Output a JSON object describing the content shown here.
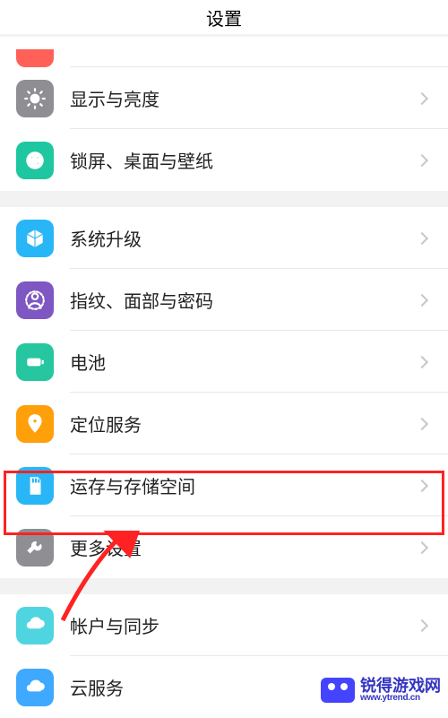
{
  "header": {
    "title": "设置"
  },
  "partial_row": {
    "icon": "sound-icon",
    "color": "#ff6159"
  },
  "groups": [
    {
      "items": [
        {
          "key": "display",
          "label": "显示与亮度",
          "icon": "brightness-icon",
          "color": "#8e8e93"
        },
        {
          "key": "wallpaper",
          "label": "锁屏、桌面与壁纸",
          "icon": "palette-icon",
          "color": "#1fc7a0"
        }
      ]
    },
    {
      "items": [
        {
          "key": "system-update",
          "label": "系统升级",
          "icon": "cube-icon",
          "color": "#29b6f6"
        },
        {
          "key": "biometrics",
          "label": "指纹、面部与密码",
          "icon": "fingerprint-icon",
          "color": "#7e57c2"
        },
        {
          "key": "battery",
          "label": "电池",
          "icon": "battery-icon",
          "color": "#26c6a0"
        },
        {
          "key": "location",
          "label": "定位服务",
          "icon": "location-icon",
          "color": "#ff9f0a"
        },
        {
          "key": "storage",
          "label": "运存与存储空间",
          "icon": "sd-card-icon",
          "color": "#29b6f6"
        },
        {
          "key": "more-settings",
          "label": "更多设置",
          "icon": "wrench-icon",
          "color": "#8e8e93",
          "highlighted": true
        }
      ]
    },
    {
      "items": [
        {
          "key": "account-sync",
          "label": "帐户与同步",
          "icon": "cloud-sync-icon",
          "color": "#4fd5e0"
        },
        {
          "key": "cloud",
          "label": "云服务",
          "icon": "cloud-icon",
          "color": "#3ea9ff"
        }
      ]
    }
  ],
  "watermark": {
    "cn": "锐得游戏网",
    "en": "www.ytrend.cn"
  }
}
